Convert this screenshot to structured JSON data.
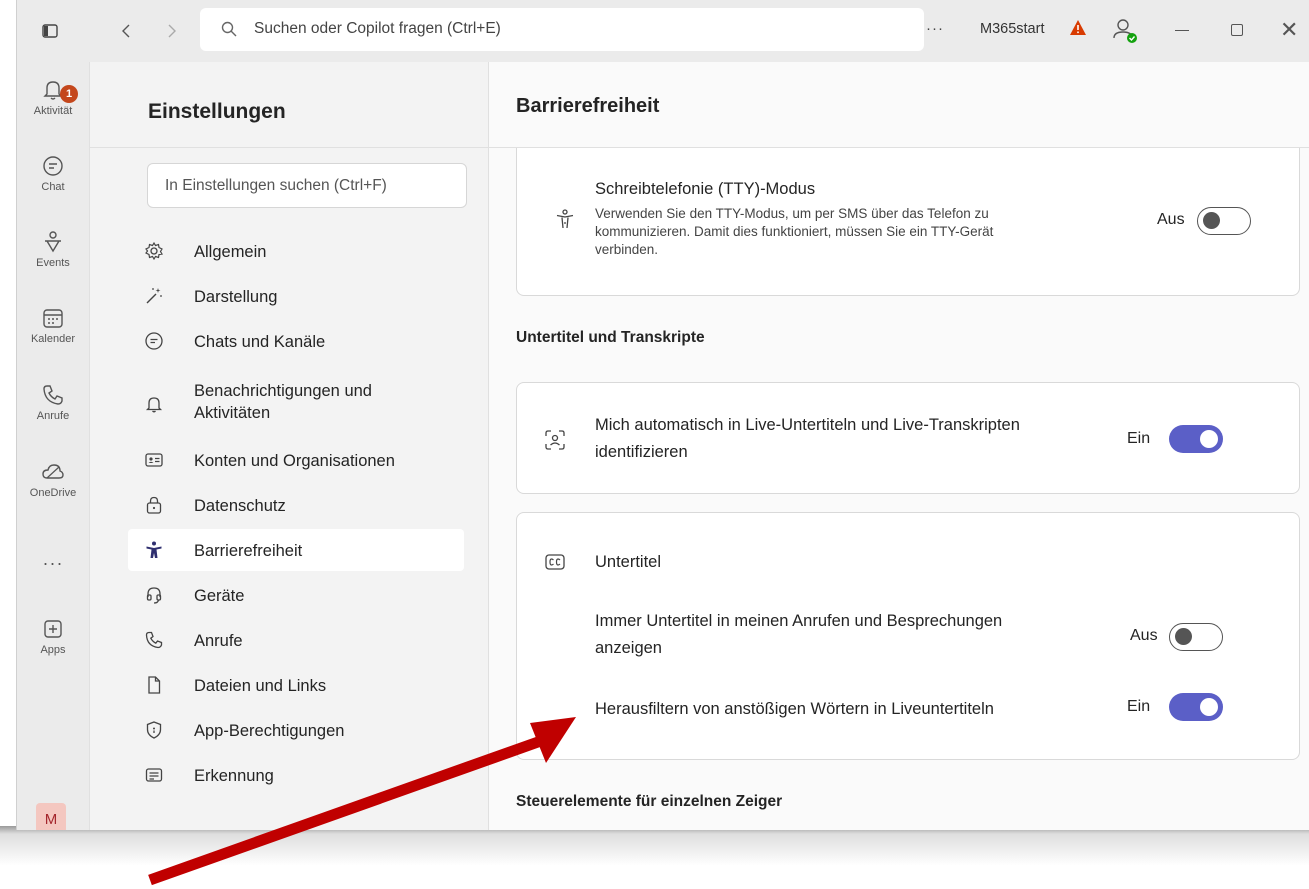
{
  "titlebar": {
    "search_placeholder": "Suchen oder Copilot fragen (Ctrl+E)",
    "more_label": "···",
    "org_name": "M365start",
    "icons": [
      "sidebar-toggle-icon",
      "back-icon",
      "forward-icon",
      "search-icon",
      "warning-icon",
      "person-status-icon",
      "minimize-icon",
      "maximize-icon",
      "close-icon"
    ]
  },
  "rail": {
    "activity": {
      "label": "Aktivität",
      "badge": "1"
    },
    "chat": {
      "label": "Chat"
    },
    "events": {
      "label": "Events"
    },
    "calendar": {
      "label": "Kalender"
    },
    "calls": {
      "label": "Anrufe"
    },
    "onedrive": {
      "label": "OneDrive"
    },
    "more": "···",
    "apps": {
      "label": "Apps"
    },
    "avatar": "M"
  },
  "settings_nav": {
    "title": "Einstellungen",
    "search_placeholder": "In Einstellungen suchen (Ctrl+F)",
    "items": [
      {
        "label": "Allgemein",
        "icon": "gear-icon"
      },
      {
        "label": "Darstellung",
        "icon": "magic-wand-icon"
      },
      {
        "label": "Chats und Kanäle",
        "icon": "chat-icon"
      },
      {
        "label": "Benachrichtigungen und Aktivitäten",
        "icon": "bell-icon"
      },
      {
        "label": "Konten und Organisationen",
        "icon": "contact-card-icon"
      },
      {
        "label": "Datenschutz",
        "icon": "lock-icon"
      },
      {
        "label": "Barrierefreiheit",
        "icon": "accessibility-icon",
        "active": true
      },
      {
        "label": "Geräte",
        "icon": "headset-icon"
      },
      {
        "label": "Anrufe",
        "icon": "phone-icon"
      },
      {
        "label": "Dateien und Links",
        "icon": "document-icon"
      },
      {
        "label": "App-Berechtigungen",
        "icon": "shield-icon"
      },
      {
        "label": "Erkennung",
        "icon": "text-box-icon"
      }
    ]
  },
  "main": {
    "title": "Barrierefreiheit",
    "tty": {
      "title": "Schreibtelefonie (TTY)-Modus",
      "desc_line1": "Verwenden Sie den TTY-Modus, um per SMS über das Telefon zu",
      "desc_line2": "kommunizieren. Damit dies funktioniert, müssen Sie ein TTY-Gerät",
      "desc_line3": "verbinden.",
      "state_label": "Aus",
      "enabled": false
    },
    "captions_section": "Untertitel und Transkripte",
    "identify": {
      "line1": "Mich automatisch in Live-Untertiteln und Live-Transkripten",
      "line2": "identifizieren",
      "state_label": "Ein",
      "enabled": true
    },
    "captions": {
      "title": "Untertitel",
      "always": {
        "line1": "Immer Untertitel in meinen Anrufen und Besprechungen",
        "line2": "anzeigen",
        "state_label": "Aus",
        "enabled": false
      },
      "filter": {
        "label": "Herausfiltern von anstößigen Wörtern in Liveuntertiteln",
        "state_label": "Ein",
        "enabled": true
      }
    },
    "pointer_section": "Steuerelemente für einzelnen Zeiger"
  },
  "colors": {
    "accent": "#5b5fc7",
    "badge": "#c4471c",
    "arrow": "#c00000"
  }
}
